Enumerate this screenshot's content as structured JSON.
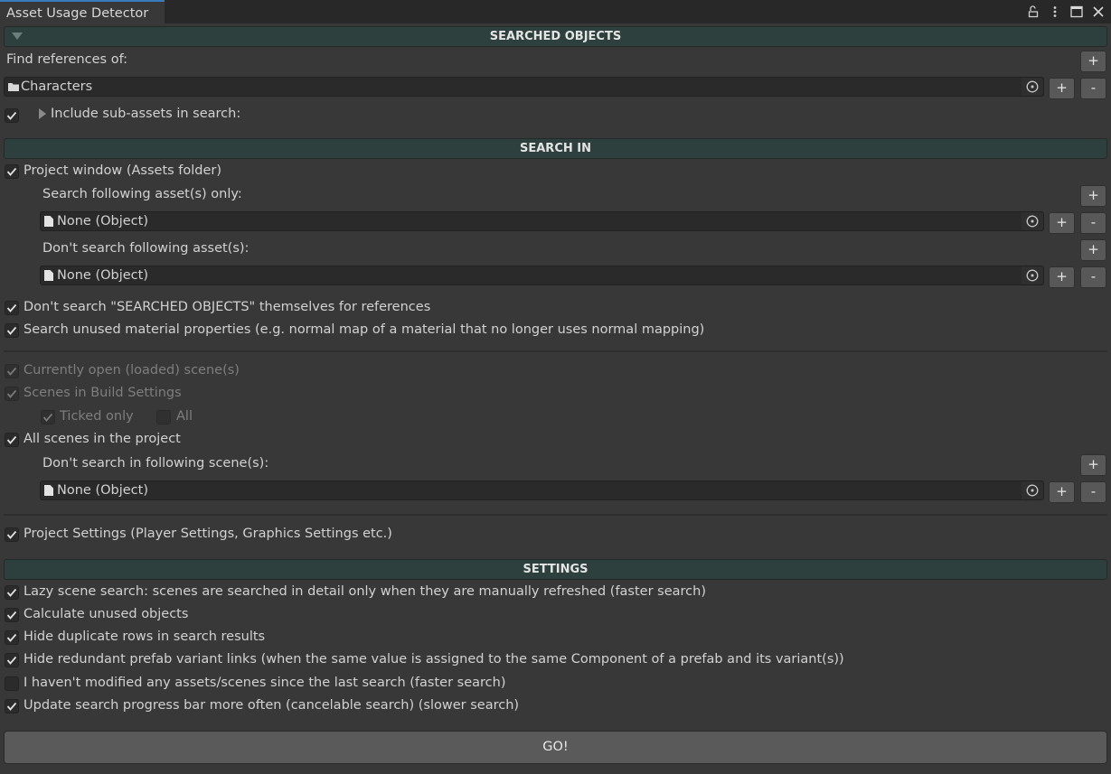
{
  "window": {
    "tab_title": "Asset Usage Detector",
    "icons": [
      "lock-icon",
      "more-options-icon",
      "maximize-icon",
      "close-icon"
    ]
  },
  "searched_objects": {
    "header": "SEARCHED OBJECTS",
    "find_label": "Find references of:",
    "object_field": {
      "icon": "folder-icon",
      "value": "Characters"
    },
    "include_subassets": {
      "checked": true,
      "label": "Include sub-assets in search:"
    },
    "buttons": {
      "add": "+",
      "remove": "-"
    }
  },
  "search_in": {
    "header": "SEARCH IN",
    "project_window": {
      "checked": true,
      "label": "Project window (Assets folder)"
    },
    "search_only_label": "Search following asset(s) only:",
    "search_only_field": {
      "icon": "file-icon",
      "value": "None (Object)"
    },
    "exclude_label": "Don't search following asset(s):",
    "exclude_field": {
      "icon": "file-icon",
      "value": "None (Object)"
    },
    "dont_search_self": {
      "checked": true,
      "label": "Don't search \"SEARCHED OBJECTS\" themselves for references"
    },
    "unused_material": {
      "checked": true,
      "label": "Search unused material properties (e.g. normal map of a material that no longer uses normal mapping)"
    },
    "open_scenes": {
      "checked": true,
      "disabled": true,
      "label": "Currently open (loaded) scene(s)"
    },
    "build_scenes": {
      "checked": true,
      "disabled": true,
      "label": "Scenes in Build Settings"
    },
    "ticked_only": {
      "checked": true,
      "disabled": true,
      "label": "Ticked only"
    },
    "all": {
      "checked": false,
      "disabled": true,
      "label": "All"
    },
    "all_scenes": {
      "checked": true,
      "label": "All scenes in the project"
    },
    "exclude_scenes_label": "Don't search in following scene(s):",
    "exclude_scenes_field": {
      "icon": "file-icon",
      "value": "None (Object)"
    },
    "project_settings": {
      "checked": true,
      "label": "Project Settings (Player Settings, Graphics Settings etc.)"
    }
  },
  "settings": {
    "header": "SETTINGS",
    "options": [
      {
        "checked": true,
        "label": "Lazy scene search: scenes are searched in detail only when they are manually refreshed (faster search)"
      },
      {
        "checked": true,
        "label": "Calculate unused objects"
      },
      {
        "checked": true,
        "label": "Hide duplicate rows in search results"
      },
      {
        "checked": true,
        "label": "Hide redundant prefab variant links (when the same value is assigned to the same Component of a prefab and its variant(s))"
      },
      {
        "checked": false,
        "label": "I haven't modified any assets/scenes since the last search (faster search)"
      },
      {
        "checked": true,
        "label": "Update search progress bar more often (cancelable search) (slower search)"
      }
    ]
  },
  "go_button": "GO!"
}
